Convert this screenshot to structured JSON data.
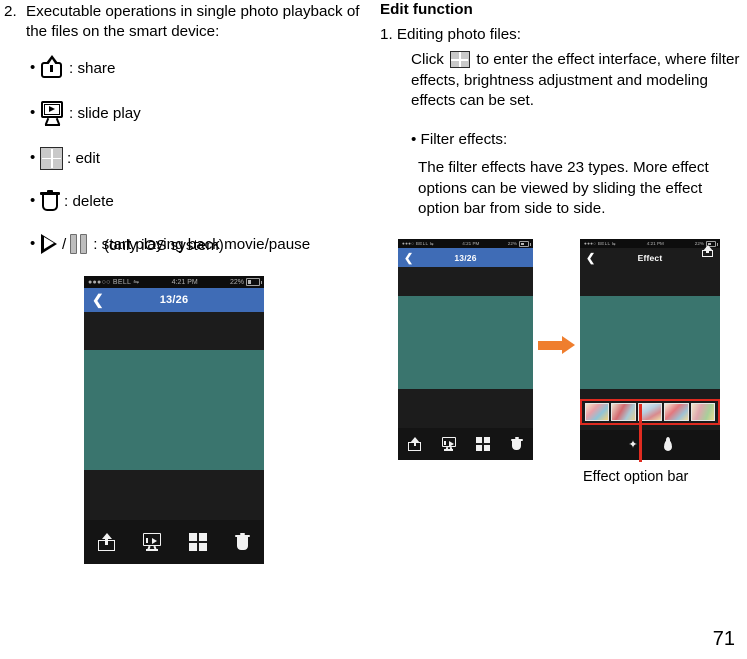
{
  "page_number": "71",
  "left_column": {
    "step_number": "2.",
    "step_text": "Executable operations in single photo playback of the files on the smart device:",
    "bullets": [
      {
        "icon": "share-icon",
        "label": ": share"
      },
      {
        "icon": "slide-play-icon",
        "label": ": slide play"
      },
      {
        "icon": "edit-icon",
        "label": ": edit"
      },
      {
        "icon": "delete-icon",
        "label": ": delete"
      },
      {
        "icon": "play-pause-icon",
        "separator": "/",
        "label": ": start playing back movie/pause"
      }
    ],
    "sub_line": "(only iOS system)"
  },
  "right_column": {
    "title": "Edit function",
    "step": "1. Editing photo files:",
    "paragraph_before_icon": "Click",
    "paragraph_after_icon": "to enter the effect interface, where filter effects, brightness adjustment and modeling effects can be set.",
    "bullet": "• Filter effects:",
    "paragraph2": "The filter effects have 23 types. More effect options can be viewed by sliding the effect option bar from side to side.",
    "callout_caption": "Effect option bar"
  },
  "phone_large": {
    "status_bar": {
      "carrier": "●●●○○ BELL ⇋",
      "time": "4:21 PM",
      "battery": "22%"
    },
    "nav": {
      "back_icon": "chevron-left-icon",
      "title": "13/26"
    },
    "toolbar_icons": [
      "share-icon",
      "slide-play-icon",
      "edit-icon",
      "delete-icon"
    ]
  },
  "phone_small_left": {
    "status_bar": {
      "carrier": "●●●○ BELL ⇋",
      "time": "4:21 PM",
      "battery": "22%"
    },
    "nav": {
      "back_icon": "chevron-left-icon",
      "title": "13/26"
    },
    "toolbar_icons": [
      "share-icon",
      "slide-play-icon",
      "edit-icon",
      "delete-icon"
    ]
  },
  "phone_small_right": {
    "status_bar": {
      "carrier": "●●●○ BELL ⇋",
      "time": "4:21 PM",
      "battery": "22%"
    },
    "nav": {
      "back_icon": "chevron-left-icon",
      "title": "Effect",
      "share_icon": "share-icon"
    },
    "effect_thumbnails_count": "5",
    "bottom_icons": [
      "magic-wand-icon",
      "brightness-drop-icon"
    ]
  },
  "colors": {
    "nav_blue": "#3f6cb6",
    "photo_teal": "#3a756e",
    "phone_dark": "#1c1c1c",
    "arrow_orange": "#ef7e2e",
    "callout_red": "#e02b20"
  }
}
